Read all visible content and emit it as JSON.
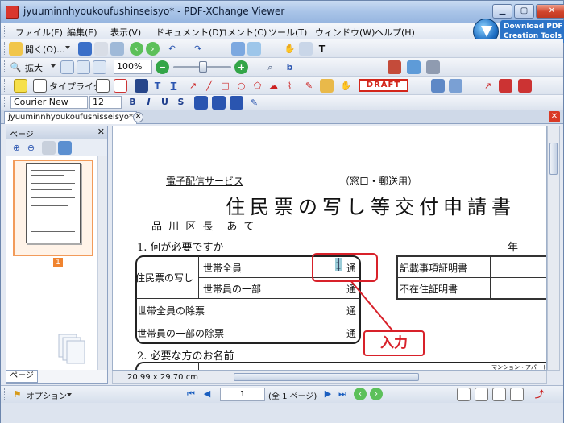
{
  "window": {
    "title": "jyuuminnhyoukoufushinseisyo* - PDF-XChange Viewer"
  },
  "menu": {
    "items": [
      "ファイル(F)",
      "編集(E)",
      "表示(V)",
      "ドキュメント(D)",
      "コメント(C)",
      "ツール(T)",
      "ウィンドウ(W)",
      "ヘルプ(H)"
    ]
  },
  "download_badge": {
    "line1": "Download PDF",
    "line2": "Creation Tools"
  },
  "toolbar1": {
    "open_label": "開く(O)..."
  },
  "toolbar2": {
    "zoom_in_label": "拡大",
    "zoom_value": "100%"
  },
  "toolbar3": {
    "typewriter_label": "タイプライター",
    "draft_stamp": "DRAFT"
  },
  "toolbar4": {
    "font_name": "Courier New",
    "font_size": "12",
    "bold": "B",
    "italic": "I",
    "underline": "U",
    "strike": "S"
  },
  "document_tab": {
    "label": "jyuuminnhyoukoufushisseisyo*"
  },
  "pages_panel": {
    "title": "ページ",
    "thumbnail_page_number": "1",
    "bottom_tab": "ページ"
  },
  "document": {
    "service_label": "電子配信サービス",
    "window_mail": "（窓口・郵送用）",
    "title": "住民票の写し等交付申請書",
    "addressee": "品 川 区 長　あ て",
    "section1": "1. 何が必要ですか",
    "year_label": "年",
    "row_jyuminhyo": "住民票の写し",
    "row_all_members": "世帯全員",
    "row_some_members": "世帯員の一部",
    "row_all_removed": "世帯全員の除票",
    "row_some_removed": "世帯員の一部の除票",
    "count_value": "1",
    "unit_tsu": "通",
    "cert_record": "記載事項証明書",
    "cert_absence": "不在住証明書",
    "section2": "2. 必要な方のお名前",
    "mansion_label": "マンション・アパート名"
  },
  "callout": {
    "text": "入力"
  },
  "status": {
    "page_size": "20.99 x 29.70 cm",
    "options_label": "オプション",
    "current_page": "1",
    "page_total": "(全 1 ページ)"
  }
}
